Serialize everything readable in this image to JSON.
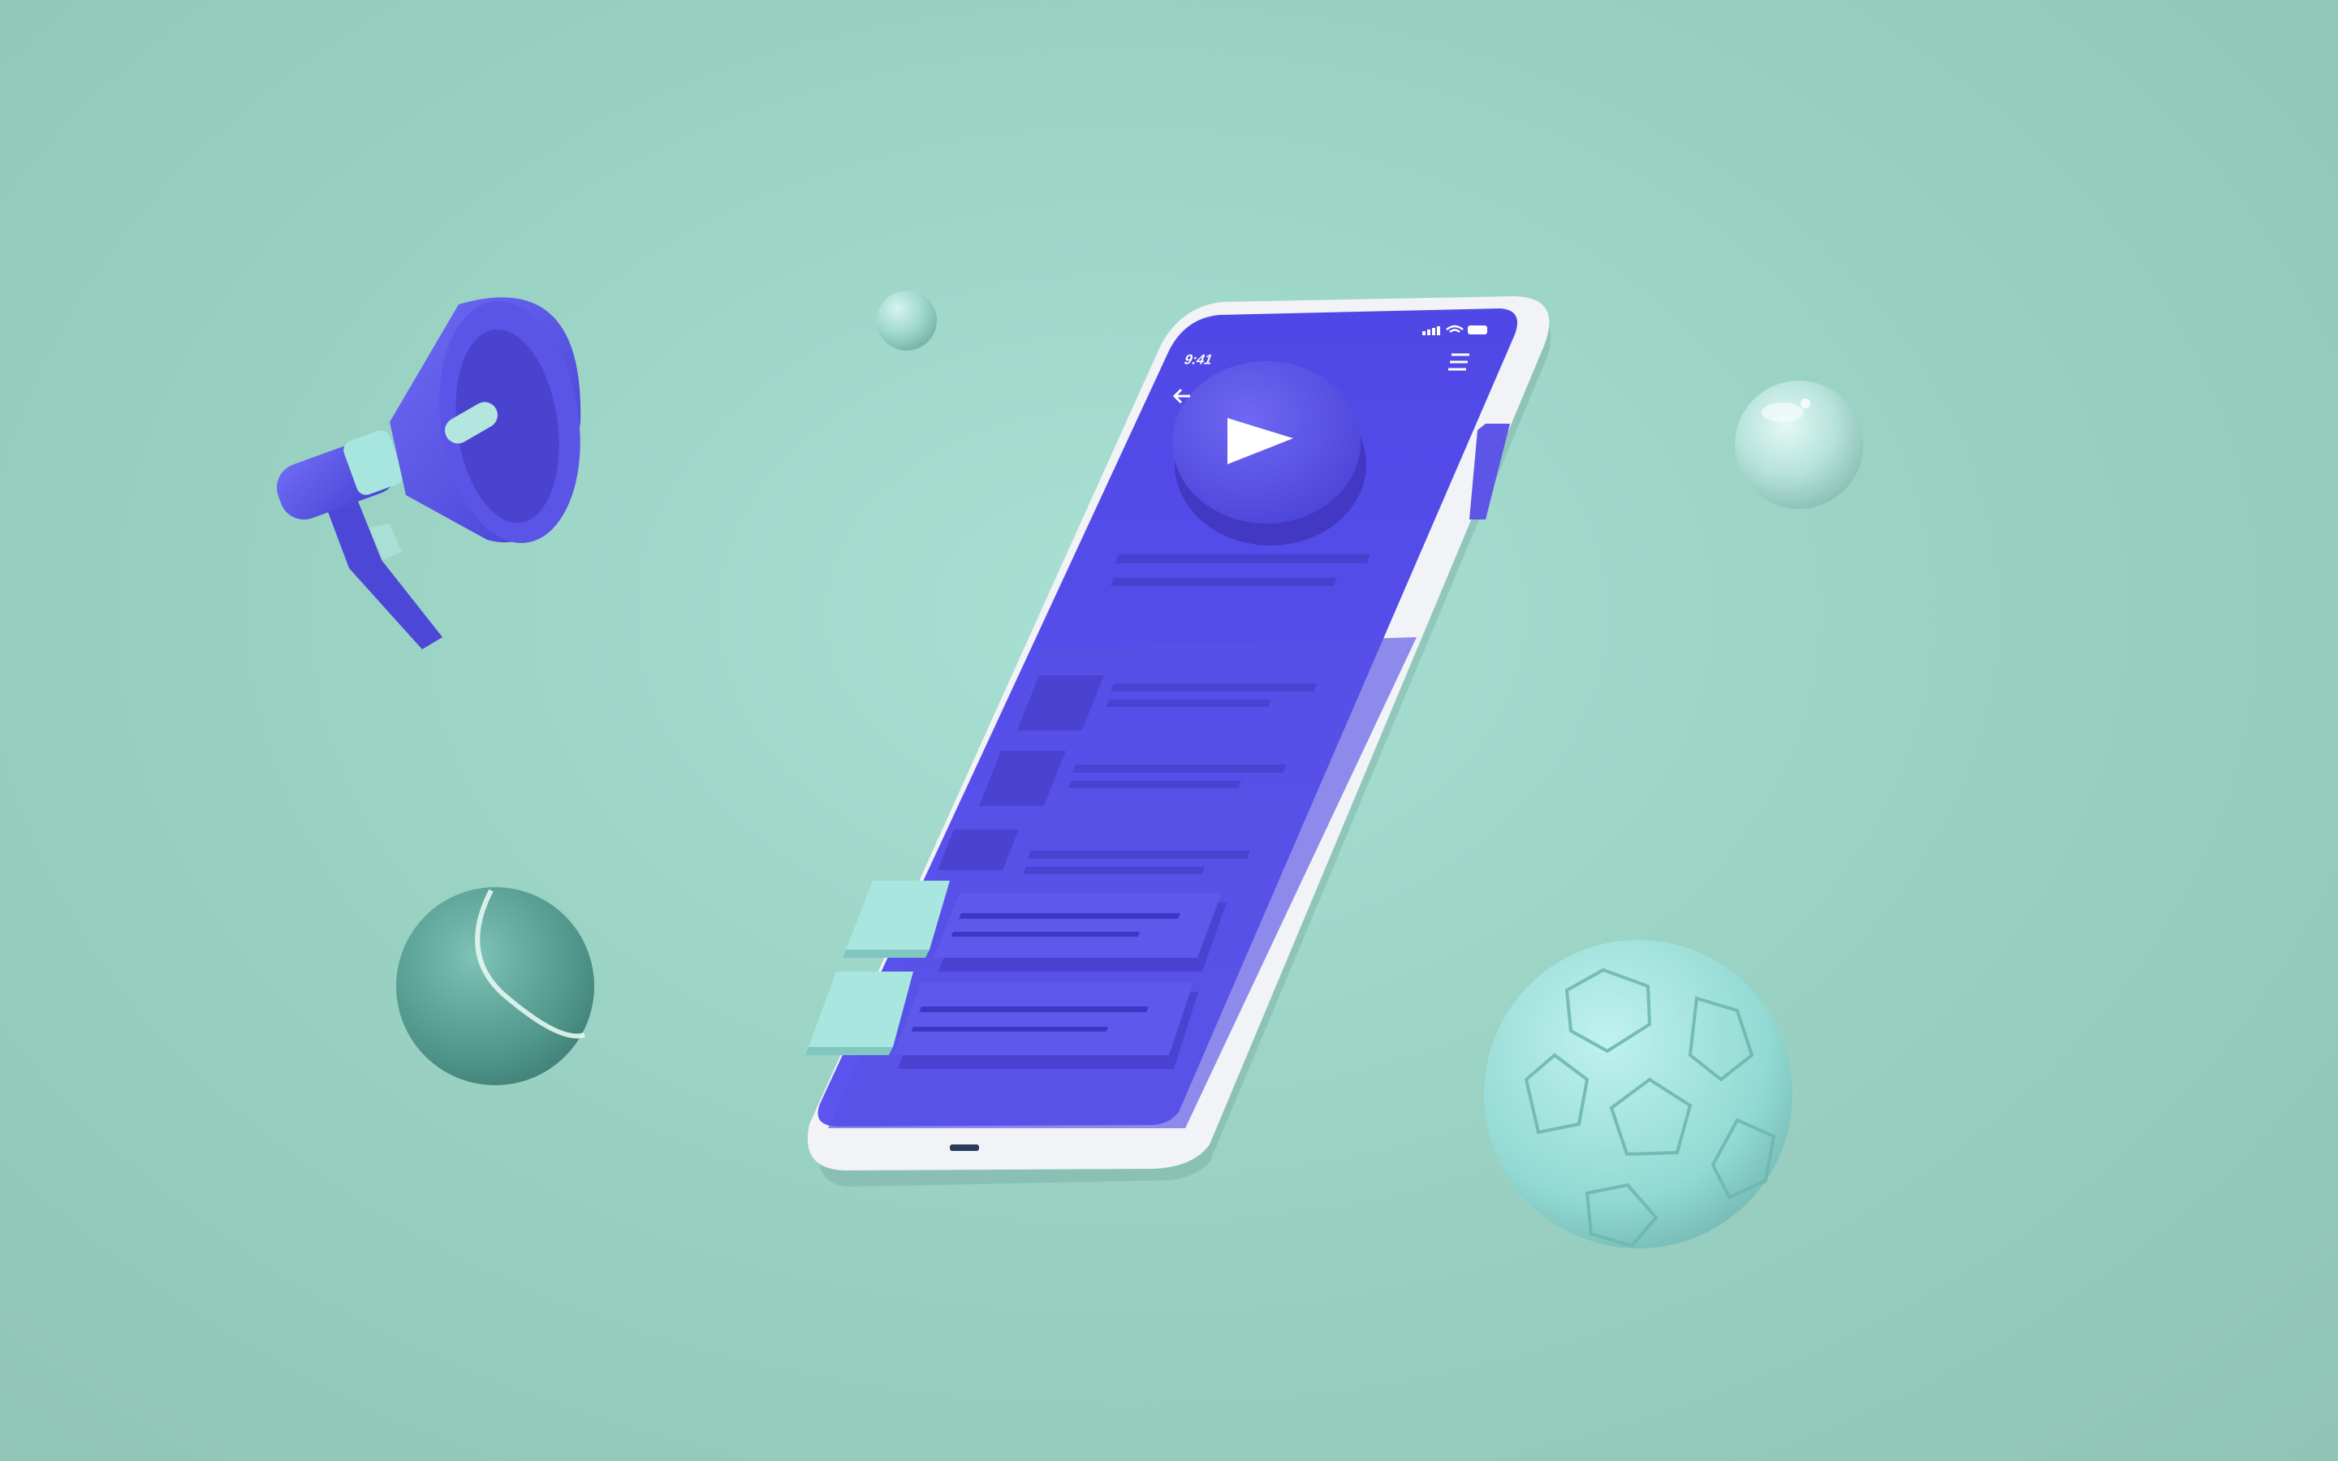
{
  "phone": {
    "status_time": "9:41",
    "screen_color": "#5a52ea",
    "frame_color": "#f4f5f7"
  },
  "colors": {
    "background": "#9ad2c4",
    "accent_purple": "#5b55e8",
    "accent_mint": "#a8e8e0"
  },
  "icons": {
    "back": "arrow-left-icon",
    "menu": "hamburger-menu-icon",
    "play": "play-icon",
    "signal": "signal-bars-icon",
    "wifi": "wifi-icon",
    "battery": "battery-icon"
  },
  "objects": [
    "megaphone",
    "tennis-ball",
    "soccer-ball",
    "glass-sphere",
    "small-sphere"
  ]
}
